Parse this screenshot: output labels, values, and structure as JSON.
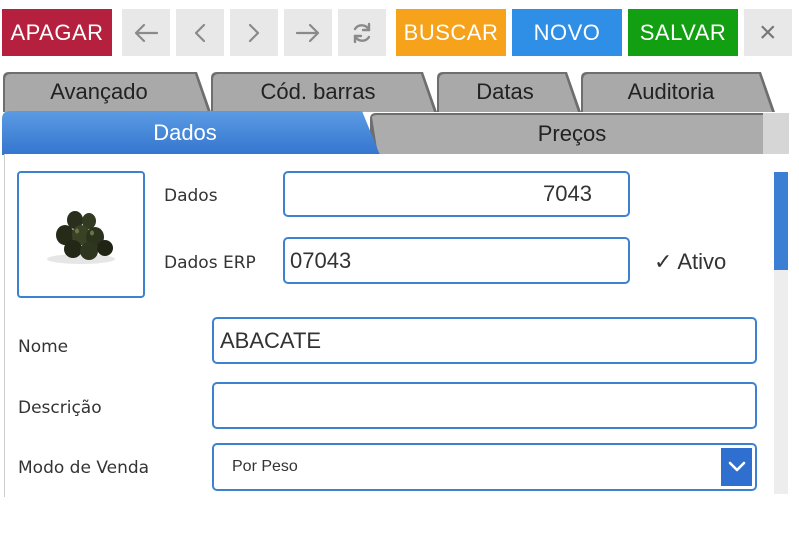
{
  "toolbar": {
    "delete_label": "APAGAR",
    "search_label": "BUSCAR",
    "new_label": "NOVO",
    "save_label": "SALVAR",
    "close_label": "×"
  },
  "tabs": {
    "row1": [
      "Avançado",
      "Cód. barras",
      "Datas",
      "Auditoria"
    ],
    "row2": [
      "Dados",
      "Preços"
    ]
  },
  "form": {
    "code_label": "Dados",
    "code_value": "7043",
    "erp_label": "Dados ERP",
    "erp_value": "07043",
    "active_label": "✓ Ativo",
    "name_label": "Nome",
    "name_value": "ABACATE",
    "description_label": "Descrição",
    "description_value": "",
    "sale_mode_label": "Modo de Venda",
    "sale_mode_value": "Por Peso"
  },
  "colors": {
    "delete": "#b5203f",
    "search": "#f7a21b",
    "new": "#2f8ee6",
    "save": "#12a012",
    "active_tab": "#3d7fd6",
    "field_border": "#3d82d0"
  },
  "icons": {
    "first": "arrow-left-icon",
    "prev": "chevron-left-icon",
    "next": "chevron-right-icon",
    "last": "arrow-right-icon",
    "refresh": "refresh-icon",
    "close": "close-icon",
    "dropdown": "chevron-down-icon"
  }
}
